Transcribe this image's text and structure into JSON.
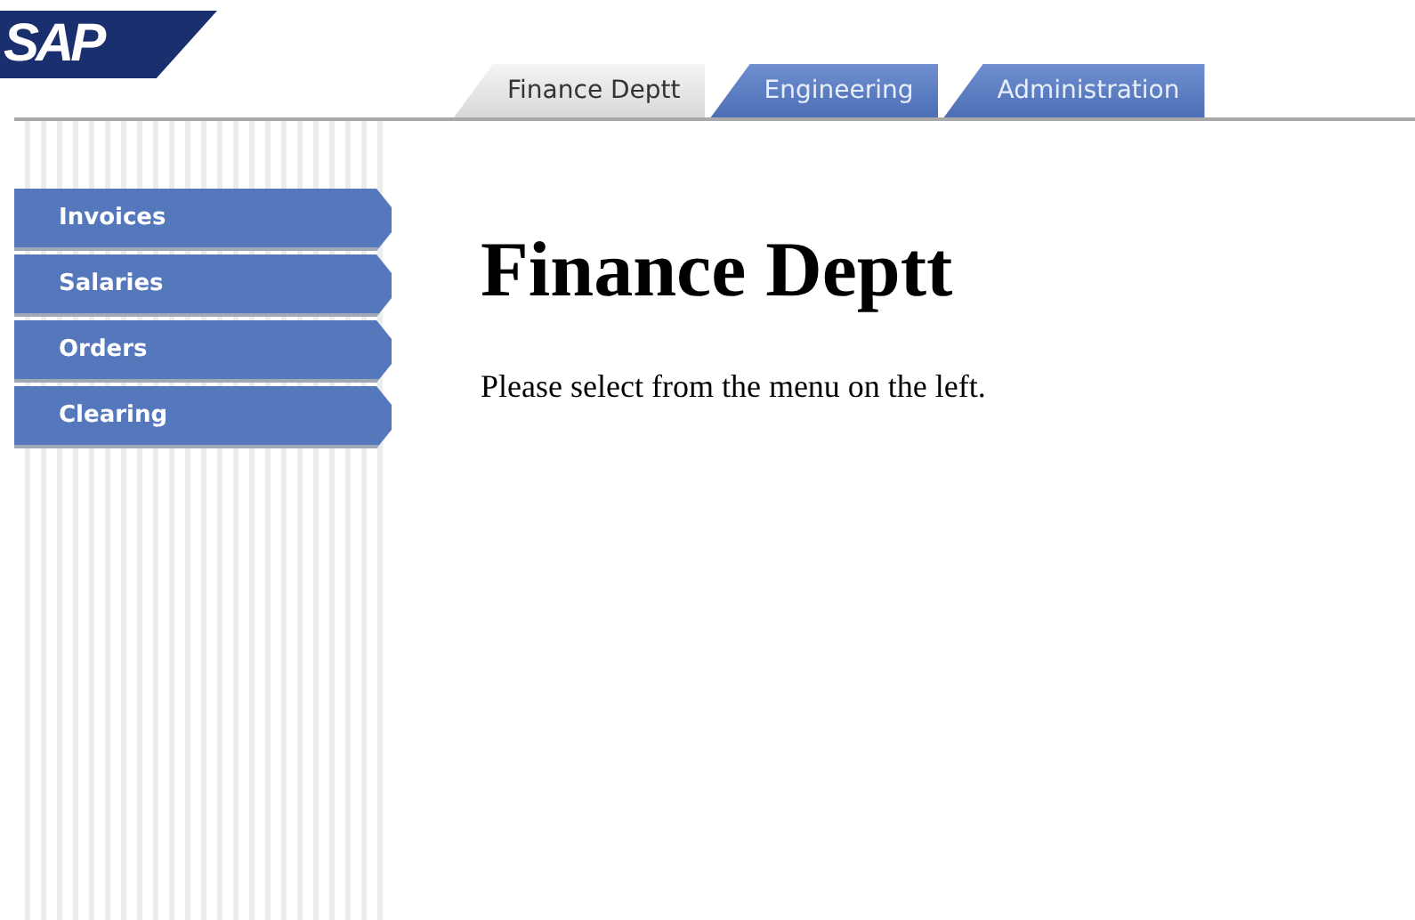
{
  "logo": {
    "text": "SAP"
  },
  "tabs": [
    {
      "label": "Finance Deptt",
      "selected": true
    },
    {
      "label": "Engineering",
      "selected": false
    },
    {
      "label": "Administration",
      "selected": false
    }
  ],
  "sidebar": {
    "items": [
      {
        "label": "Invoices"
      },
      {
        "label": "Salaries"
      },
      {
        "label": "Orders"
      },
      {
        "label": "Clearing"
      }
    ]
  },
  "content": {
    "heading": "Finance Deptt",
    "text": "Please select from the menu on the left."
  }
}
